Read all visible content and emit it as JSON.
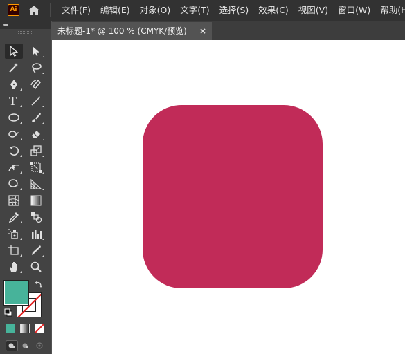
{
  "app": {
    "logo_text": "Ai",
    "logo_color": "#ff9a00",
    "home_icon": "home-icon"
  },
  "menu": [
    {
      "label": "文件(F)"
    },
    {
      "label": "编辑(E)"
    },
    {
      "label": "对象(O)"
    },
    {
      "label": "文字(T)"
    },
    {
      "label": "选择(S)"
    },
    {
      "label": "效果(C)"
    },
    {
      "label": "视图(V)"
    },
    {
      "label": "窗口(W)"
    },
    {
      "label": "帮助(H)"
    }
  ],
  "toolbar": {
    "collapse_icon": "double-chevron-left-icon",
    "tools": [
      {
        "name": "selection-tool",
        "icon": "arrow-icon",
        "active": true
      },
      {
        "name": "direct-selection-tool",
        "icon": "white-arrow-icon"
      },
      {
        "name": "magic-wand-tool",
        "icon": "magic-wand-icon"
      },
      {
        "name": "lasso-tool",
        "icon": "lasso-icon"
      },
      {
        "name": "pen-tool",
        "icon": "pen-icon"
      },
      {
        "name": "curvature-tool",
        "icon": "curvature-icon"
      },
      {
        "name": "type-tool",
        "icon": "type-icon",
        "glyph": "T"
      },
      {
        "name": "line-segment-tool",
        "icon": "line-icon"
      },
      {
        "name": "ellipse-tool",
        "icon": "ellipse-icon"
      },
      {
        "name": "paintbrush-tool",
        "icon": "brush-icon"
      },
      {
        "name": "shaper-tool",
        "icon": "shaper-icon"
      },
      {
        "name": "eraser-tool",
        "icon": "eraser-icon"
      },
      {
        "name": "rotate-tool",
        "icon": "rotate-icon"
      },
      {
        "name": "scale-tool",
        "icon": "scale-icon"
      },
      {
        "name": "width-tool",
        "icon": "width-icon"
      },
      {
        "name": "free-transform-tool",
        "icon": "free-transform-icon"
      },
      {
        "name": "shape-builder-tool",
        "icon": "shape-builder-icon"
      },
      {
        "name": "perspective-grid-tool",
        "icon": "perspective-grid-icon"
      },
      {
        "name": "mesh-tool",
        "icon": "mesh-icon"
      },
      {
        "name": "gradient-tool",
        "icon": "gradient-icon"
      },
      {
        "name": "eyedropper-tool",
        "icon": "eyedropper-icon"
      },
      {
        "name": "blend-tool",
        "icon": "blend-icon"
      },
      {
        "name": "symbol-sprayer-tool",
        "icon": "symbol-sprayer-icon"
      },
      {
        "name": "column-graph-tool",
        "icon": "bar-graph-icon"
      },
      {
        "name": "artboard-tool",
        "icon": "artboard-icon"
      },
      {
        "name": "slice-tool",
        "icon": "slice-icon"
      },
      {
        "name": "hand-tool",
        "icon": "hand-icon"
      },
      {
        "name": "zoom-tool",
        "icon": "zoom-icon"
      }
    ],
    "fill_color": "#47b39a",
    "stroke": "none",
    "swap_icon": "swap-arrows-icon",
    "default_colors_icon": "default-fill-stroke-icon",
    "modes": [
      "color-mode-icon",
      "gradient-mode-icon",
      "none-mode-icon"
    ],
    "draw_modes": [
      "draw-normal-icon",
      "draw-behind-icon",
      "draw-inside-icon"
    ]
  },
  "document": {
    "tab_title": "未标题-1* @ 100 % (CMYK/预览)",
    "close_glyph": "×"
  },
  "artwork": {
    "shape": "rounded-rectangle",
    "fill": "#c12b58"
  }
}
